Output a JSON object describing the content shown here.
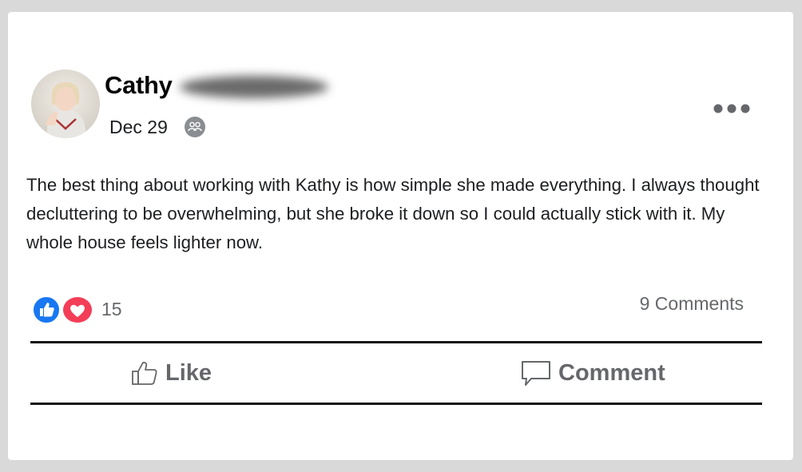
{
  "post": {
    "author_name": "Cathy",
    "date": "Dec 29",
    "privacy_icon": "friends-icon",
    "more_icon": "more-options-icon",
    "text": "The best thing about working with Kathy is how simple she made everything. I always thought decluttering to be overwhelming, but she broke it down so I could actually stick with it. My whole house feels lighter now."
  },
  "stats": {
    "reaction_icons": [
      "like-reaction-icon",
      "love-reaction-icon"
    ],
    "reaction_count": "15",
    "comments_label": "9 Comments"
  },
  "actions": {
    "like_label": "Like",
    "comment_label": "Comment"
  },
  "colors": {
    "like_blue": "#1877f2",
    "love_red": "#f33e58",
    "secondary_text": "#65676b"
  }
}
